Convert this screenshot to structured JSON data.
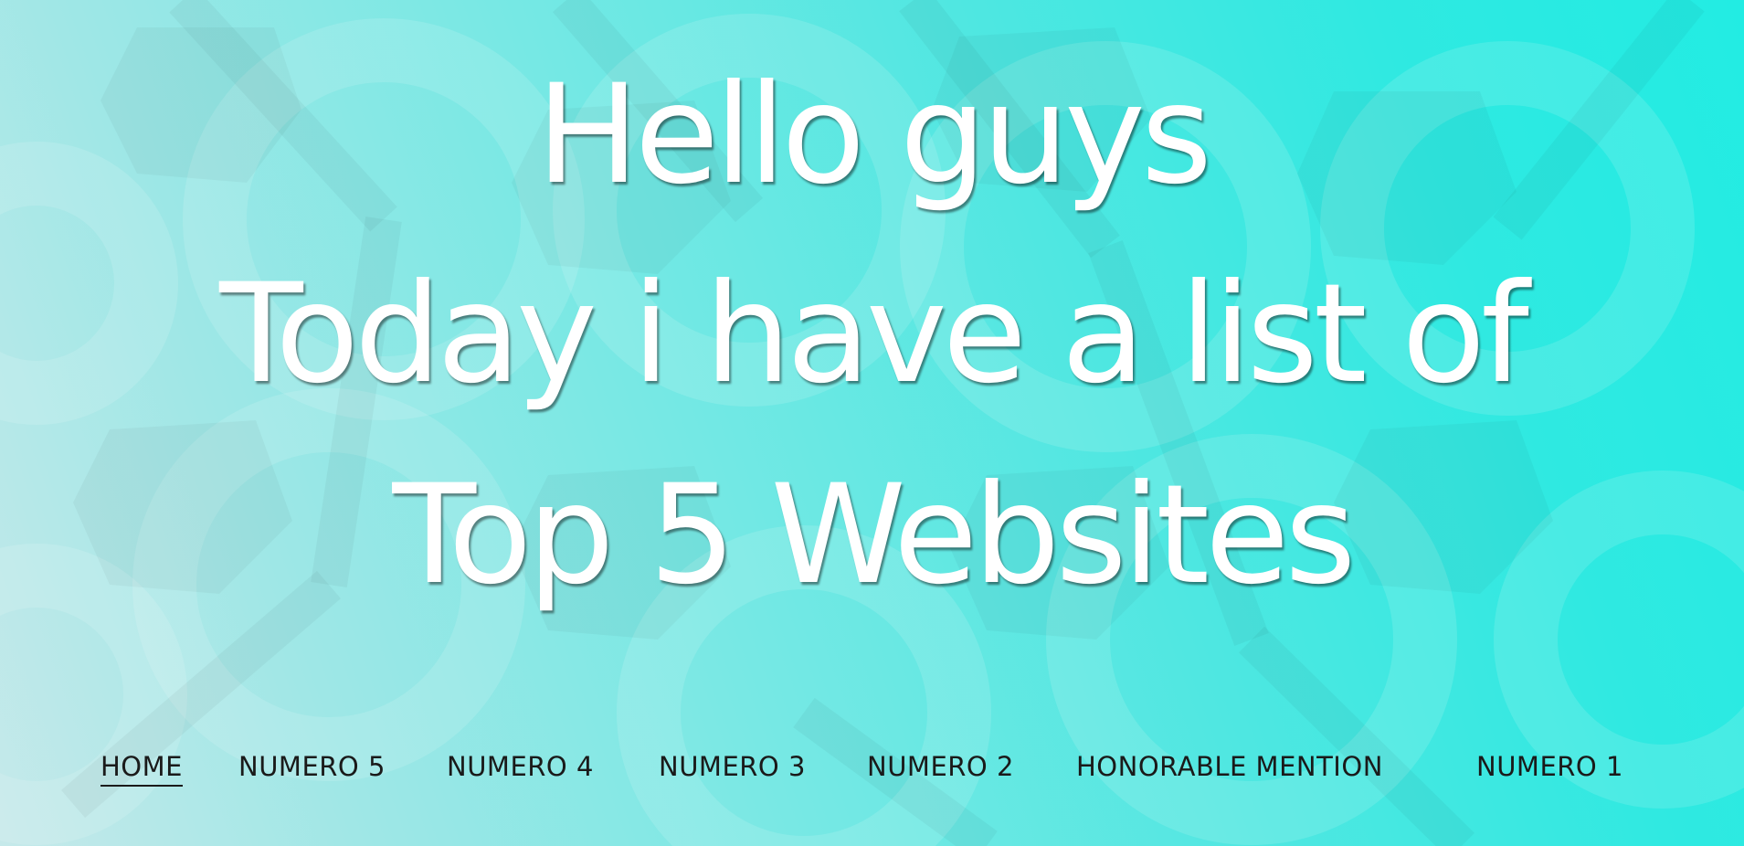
{
  "hero": {
    "line1": "Hello guys",
    "line2": "Today i have a list of",
    "line3": "Top 5 Websites"
  },
  "nav": {
    "items": [
      {
        "label": "HOME",
        "active": true
      },
      {
        "label": "NUMERO 5",
        "active": false
      },
      {
        "label": "NUMERO 4",
        "active": false
      },
      {
        "label": "NUMERO 3",
        "active": false
      },
      {
        "label": "NUMERO 2",
        "active": false
      },
      {
        "label": "HONORABLE MENTION",
        "active": false
      },
      {
        "label": "NUMERO 1",
        "active": false
      }
    ]
  },
  "colors": {
    "background_start": "#c6e9ea",
    "background_end": "#22ece3",
    "headline_text": "#ffffff",
    "nav_text": "#1a1a1a"
  }
}
